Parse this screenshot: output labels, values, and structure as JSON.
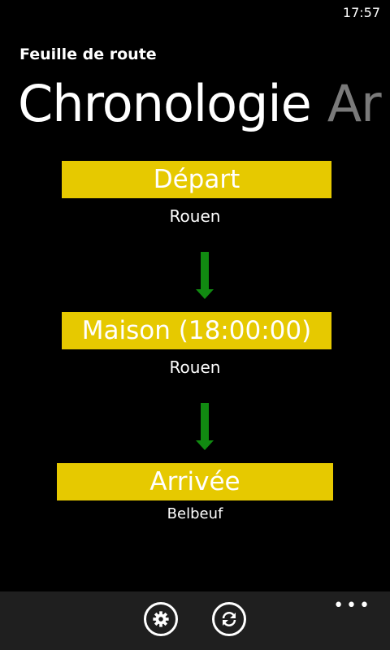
{
  "status": {
    "time": "17:57"
  },
  "app": {
    "title": "Feuille de route"
  },
  "pivot": {
    "active": "Chronologie",
    "next": "Ar"
  },
  "steps": [
    {
      "label": "Départ",
      "place": "Rouen"
    },
    {
      "label": "Maison  (18:00:00)",
      "place": "Rouen"
    },
    {
      "label": "Arrivée",
      "place": "Belbeuf"
    }
  ],
  "appbar": {
    "buttons": [
      {
        "icon": "settings-icon"
      },
      {
        "icon": "refresh-icon"
      }
    ],
    "more": "•••"
  },
  "colors": {
    "step_box": "#e6c900",
    "arrow": "#118a11",
    "appbar": "#1f1f1f"
  }
}
